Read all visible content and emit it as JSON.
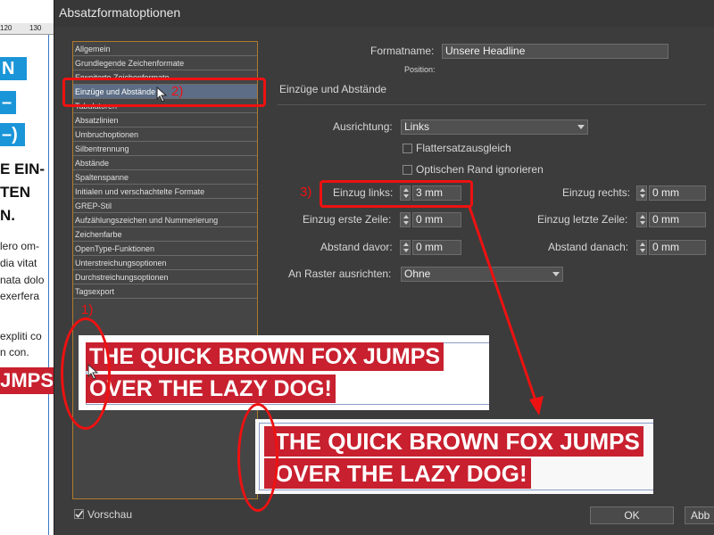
{
  "background_doc": {
    "ruler": [
      "120",
      "130"
    ],
    "blue_labels": [
      "N",
      "–",
      "–)"
    ],
    "heading_lines": [
      "E EIN-",
      "TEN",
      "N."
    ],
    "body_lines": [
      "lero om-",
      "dia vitat",
      "nata dolo",
      "exerfera",
      "expliti co",
      "n con."
    ],
    "red_text": "JMPS"
  },
  "dialog": {
    "title": "Absatzformatoptionen",
    "categories": [
      "Allgemein",
      "Grundlegende Zeichenformate",
      "Erweiterte Zeichenformate",
      "Einzüge und Abstände",
      "Tabulatoren",
      "Absatzlinien",
      "Umbruchoptionen",
      "Silbentrennung",
      "Abstände",
      "Spaltenspanne",
      "Initialen und verschachtelte Formate",
      "GREP-Stil",
      "Aufzählungszeichen und Nummerierung",
      "Zeichenfarbe",
      "OpenType-Funktionen",
      "Unterstreichungsoptionen",
      "Durchstreichungsoptionen",
      "Tagsexport"
    ],
    "selected_category": "Einzüge und Abstände",
    "formatname_label": "Formatname:",
    "formatname_value": "Unsere Headline",
    "position_label": "Position:",
    "section_title": "Einzüge und Abstände",
    "ausrichtung_label": "Ausrichtung:",
    "ausrichtung_value": "Links",
    "flattersatz_label": "Flattersatzausgleich",
    "optischer_rand_label": "Optischen Rand ignorieren",
    "einzug_links_label": "Einzug links:",
    "einzug_links_value": "3 mm",
    "einzug_rechts_label": "Einzug rechts:",
    "einzug_rechts_value": "0 mm",
    "einzug_erste_label": "Einzug erste Zeile:",
    "einzug_erste_value": "0 mm",
    "einzug_letzte_label": "Einzug letzte Zeile:",
    "einzug_letzte_value": "0 mm",
    "abstand_davor_label": "Abstand davor:",
    "abstand_davor_value": "0 mm",
    "abstand_danach_label": "Abstand danach:",
    "abstand_danach_value": "0 mm",
    "raster_label": "An Raster ausrichten:",
    "raster_value": "Ohne",
    "vorschau_label": "Vorschau",
    "vorschau_checked": true,
    "ok_label": "OK",
    "abbrechen_label": "Abb"
  },
  "annotations": {
    "step1": "1)",
    "step2": "2)",
    "step3": "3)",
    "color": "#ee1111"
  },
  "samples": {
    "line1": "THE QUICK BROWN FOX JUMPS",
    "line2": "OVER THE LAZY DOG!",
    "color": "#c8202f"
  },
  "colors": {
    "dialog_bg": "#3c3c3c",
    "selected_bg": "#5c6d85",
    "list_border": "#b07a2c",
    "doc_blue": "#1a95d8"
  }
}
